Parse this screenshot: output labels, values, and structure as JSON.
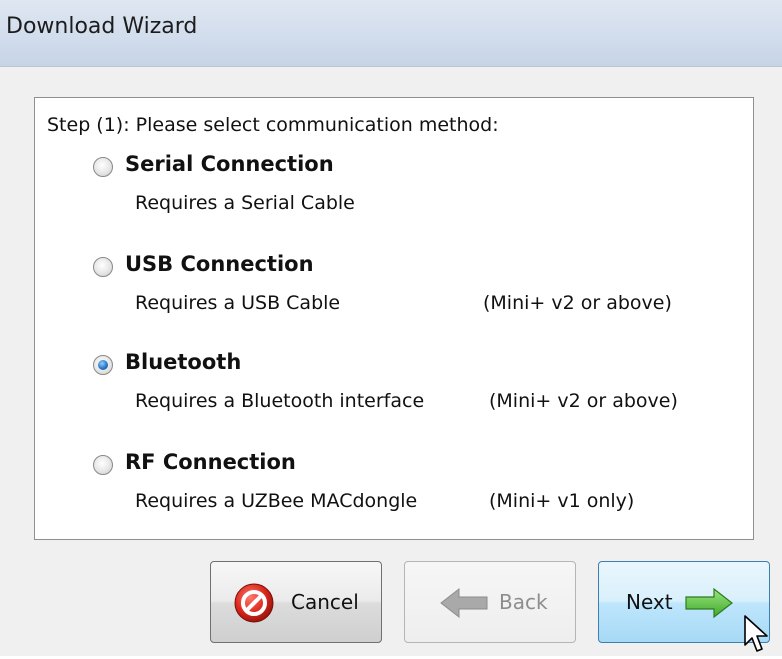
{
  "window": {
    "title": "Download Wizard"
  },
  "step_label": "Step (1): Please select communication method:",
  "options": [
    {
      "title": "Serial Connection",
      "description": "Requires a Serial Cable",
      "note": "",
      "selected": false
    },
    {
      "title": "USB Connection",
      "description": "Requires a USB Cable",
      "note": "(Mini+ v2 or above)",
      "selected": false
    },
    {
      "title": "Bluetooth",
      "description": "Requires a Bluetooth interface",
      "note": "(Mini+ v2 or above)",
      "selected": true
    },
    {
      "title": "RF Connection",
      "description": "Requires a UZBee MACdongle",
      "note": "(Mini+ v1 only)",
      "selected": false
    }
  ],
  "buttons": {
    "cancel": {
      "label": "Cancel",
      "icon": "cancel-icon",
      "enabled": true
    },
    "back": {
      "label": "Back",
      "icon": "back-arrow-icon",
      "enabled": false
    },
    "next": {
      "label": "Next",
      "icon": "next-arrow-icon",
      "enabled": true
    }
  },
  "colors": {
    "accent": "#2a77c9",
    "next_arrow": "#5fc443",
    "cancel_icon": "#d9261c",
    "disabled_arrow": "#a9a9a9"
  }
}
